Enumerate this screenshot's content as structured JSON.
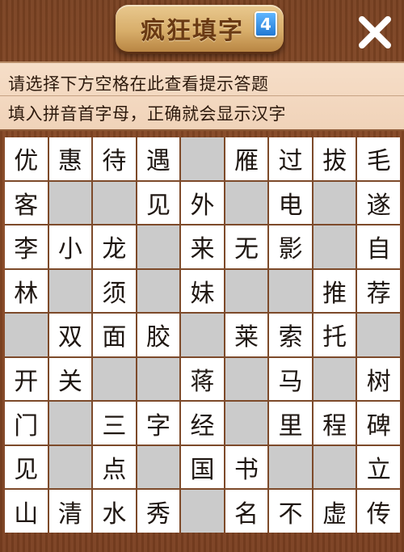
{
  "header": {
    "title": "疯狂填字",
    "badge": "4",
    "close_label": "close"
  },
  "hint": {
    "line1": "请选择下方空格在此查看提示答题",
    "line2": "填入拼音首字母，正确就会显示汉字"
  },
  "grid": [
    [
      "优",
      "惠",
      "待",
      "遇",
      "",
      "雁",
      "过",
      "拔",
      "毛"
    ],
    [
      "客",
      "",
      "",
      "见",
      "外",
      "",
      "电",
      "",
      "遂"
    ],
    [
      "李",
      "小",
      "龙",
      "",
      "来",
      "无",
      "影",
      "",
      "自"
    ],
    [
      "林",
      "",
      "须",
      "",
      "妹",
      "",
      "",
      "推",
      "荐"
    ],
    [
      "",
      "双",
      "面",
      "胶",
      "",
      "莱",
      "索",
      "托",
      ""
    ],
    [
      "开",
      "关",
      "",
      "",
      "蒋",
      "",
      "马",
      "",
      "树"
    ],
    [
      "门",
      "",
      "三",
      "字",
      "经",
      "",
      "里",
      "程",
      "碑"
    ],
    [
      "见",
      "",
      "点",
      "",
      "国",
      "书",
      "",
      "",
      "立"
    ],
    [
      "山",
      "清",
      "水",
      "秀",
      "",
      "名",
      "不",
      "虚",
      "传"
    ]
  ],
  "colors": {
    "wood": "#8a4a25",
    "cell_filled": "#ffffff",
    "cell_blank": "#cbcbcb",
    "hint_bg": "#f6dec8",
    "badge": "#2179d3"
  }
}
